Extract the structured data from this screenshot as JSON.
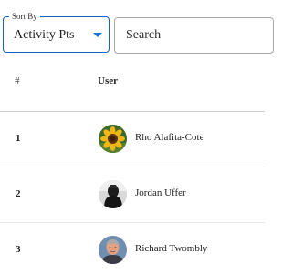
{
  "sort": {
    "legend": "Sort By",
    "selected": "Activity Pts"
  },
  "search": {
    "placeholder": "Search",
    "value": ""
  },
  "table": {
    "headers": {
      "rank": "#",
      "user": "User"
    },
    "rows": [
      {
        "rank": "1",
        "name": "Rho Alafita-Cote",
        "avatar": "sunflower-avatar"
      },
      {
        "rank": "2",
        "name": "Jordan Uffer",
        "avatar": "dark-figure-avatar"
      },
      {
        "rank": "3",
        "name": "Richard Twombly",
        "avatar": "person-photo-avatar"
      }
    ]
  },
  "colors": {
    "accent": "#1976d2",
    "select_border": "#1565c0",
    "input_border": "#a9a9a9",
    "divider": "#cfcfcf"
  }
}
